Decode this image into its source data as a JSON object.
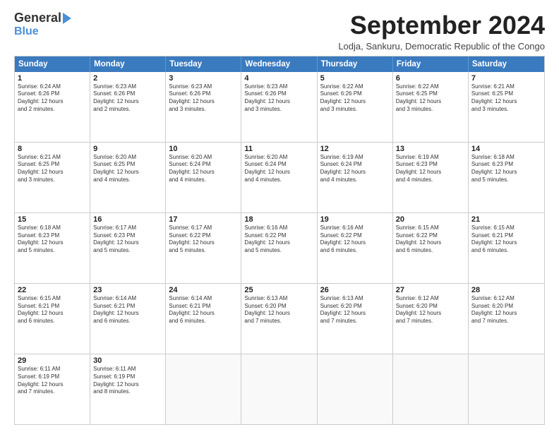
{
  "logo": {
    "line1": "General",
    "line2": "Blue"
  },
  "title": "September 2024",
  "subtitle": "Lodja, Sankuru, Democratic Republic of the Congo",
  "headers": [
    "Sunday",
    "Monday",
    "Tuesday",
    "Wednesday",
    "Thursday",
    "Friday",
    "Saturday"
  ],
  "weeks": [
    [
      {
        "day": "1",
        "lines": [
          "Sunrise: 6:24 AM",
          "Sunset: 6:26 PM",
          "Daylight: 12 hours",
          "and 2 minutes."
        ]
      },
      {
        "day": "2",
        "lines": [
          "Sunrise: 6:23 AM",
          "Sunset: 6:26 PM",
          "Daylight: 12 hours",
          "and 2 minutes."
        ]
      },
      {
        "day": "3",
        "lines": [
          "Sunrise: 6:23 AM",
          "Sunset: 6:26 PM",
          "Daylight: 12 hours",
          "and 3 minutes."
        ]
      },
      {
        "day": "4",
        "lines": [
          "Sunrise: 6:23 AM",
          "Sunset: 6:26 PM",
          "Daylight: 12 hours",
          "and 3 minutes."
        ]
      },
      {
        "day": "5",
        "lines": [
          "Sunrise: 6:22 AM",
          "Sunset: 6:26 PM",
          "Daylight: 12 hours",
          "and 3 minutes."
        ]
      },
      {
        "day": "6",
        "lines": [
          "Sunrise: 6:22 AM",
          "Sunset: 6:25 PM",
          "Daylight: 12 hours",
          "and 3 minutes."
        ]
      },
      {
        "day": "7",
        "lines": [
          "Sunrise: 6:21 AM",
          "Sunset: 6:25 PM",
          "Daylight: 12 hours",
          "and 3 minutes."
        ]
      }
    ],
    [
      {
        "day": "8",
        "lines": [
          "Sunrise: 6:21 AM",
          "Sunset: 6:25 PM",
          "Daylight: 12 hours",
          "and 3 minutes."
        ]
      },
      {
        "day": "9",
        "lines": [
          "Sunrise: 6:20 AM",
          "Sunset: 6:25 PM",
          "Daylight: 12 hours",
          "and 4 minutes."
        ]
      },
      {
        "day": "10",
        "lines": [
          "Sunrise: 6:20 AM",
          "Sunset: 6:24 PM",
          "Daylight: 12 hours",
          "and 4 minutes."
        ]
      },
      {
        "day": "11",
        "lines": [
          "Sunrise: 6:20 AM",
          "Sunset: 6:24 PM",
          "Daylight: 12 hours",
          "and 4 minutes."
        ]
      },
      {
        "day": "12",
        "lines": [
          "Sunrise: 6:19 AM",
          "Sunset: 6:24 PM",
          "Daylight: 12 hours",
          "and 4 minutes."
        ]
      },
      {
        "day": "13",
        "lines": [
          "Sunrise: 6:19 AM",
          "Sunset: 6:23 PM",
          "Daylight: 12 hours",
          "and 4 minutes."
        ]
      },
      {
        "day": "14",
        "lines": [
          "Sunrise: 6:18 AM",
          "Sunset: 6:23 PM",
          "Daylight: 12 hours",
          "and 5 minutes."
        ]
      }
    ],
    [
      {
        "day": "15",
        "lines": [
          "Sunrise: 6:18 AM",
          "Sunset: 6:23 PM",
          "Daylight: 12 hours",
          "and 5 minutes."
        ]
      },
      {
        "day": "16",
        "lines": [
          "Sunrise: 6:17 AM",
          "Sunset: 6:23 PM",
          "Daylight: 12 hours",
          "and 5 minutes."
        ]
      },
      {
        "day": "17",
        "lines": [
          "Sunrise: 6:17 AM",
          "Sunset: 6:22 PM",
          "Daylight: 12 hours",
          "and 5 minutes."
        ]
      },
      {
        "day": "18",
        "lines": [
          "Sunrise: 6:16 AM",
          "Sunset: 6:22 PM",
          "Daylight: 12 hours",
          "and 5 minutes."
        ]
      },
      {
        "day": "19",
        "lines": [
          "Sunrise: 6:16 AM",
          "Sunset: 6:22 PM",
          "Daylight: 12 hours",
          "and 6 minutes."
        ]
      },
      {
        "day": "20",
        "lines": [
          "Sunrise: 6:15 AM",
          "Sunset: 6:22 PM",
          "Daylight: 12 hours",
          "and 6 minutes."
        ]
      },
      {
        "day": "21",
        "lines": [
          "Sunrise: 6:15 AM",
          "Sunset: 6:21 PM",
          "Daylight: 12 hours",
          "and 6 minutes."
        ]
      }
    ],
    [
      {
        "day": "22",
        "lines": [
          "Sunrise: 6:15 AM",
          "Sunset: 6:21 PM",
          "Daylight: 12 hours",
          "and 6 minutes."
        ]
      },
      {
        "day": "23",
        "lines": [
          "Sunrise: 6:14 AM",
          "Sunset: 6:21 PM",
          "Daylight: 12 hours",
          "and 6 minutes."
        ]
      },
      {
        "day": "24",
        "lines": [
          "Sunrise: 6:14 AM",
          "Sunset: 6:21 PM",
          "Daylight: 12 hours",
          "and 6 minutes."
        ]
      },
      {
        "day": "25",
        "lines": [
          "Sunrise: 6:13 AM",
          "Sunset: 6:20 PM",
          "Daylight: 12 hours",
          "and 7 minutes."
        ]
      },
      {
        "day": "26",
        "lines": [
          "Sunrise: 6:13 AM",
          "Sunset: 6:20 PM",
          "Daylight: 12 hours",
          "and 7 minutes."
        ]
      },
      {
        "day": "27",
        "lines": [
          "Sunrise: 6:12 AM",
          "Sunset: 6:20 PM",
          "Daylight: 12 hours",
          "and 7 minutes."
        ]
      },
      {
        "day": "28",
        "lines": [
          "Sunrise: 6:12 AM",
          "Sunset: 6:20 PM",
          "Daylight: 12 hours",
          "and 7 minutes."
        ]
      }
    ],
    [
      {
        "day": "29",
        "lines": [
          "Sunrise: 6:11 AM",
          "Sunset: 6:19 PM",
          "Daylight: 12 hours",
          "and 7 minutes."
        ]
      },
      {
        "day": "30",
        "lines": [
          "Sunrise: 6:11 AM",
          "Sunset: 6:19 PM",
          "Daylight: 12 hours",
          "and 8 minutes."
        ]
      },
      {
        "day": "",
        "lines": []
      },
      {
        "day": "",
        "lines": []
      },
      {
        "day": "",
        "lines": []
      },
      {
        "day": "",
        "lines": []
      },
      {
        "day": "",
        "lines": []
      }
    ]
  ]
}
